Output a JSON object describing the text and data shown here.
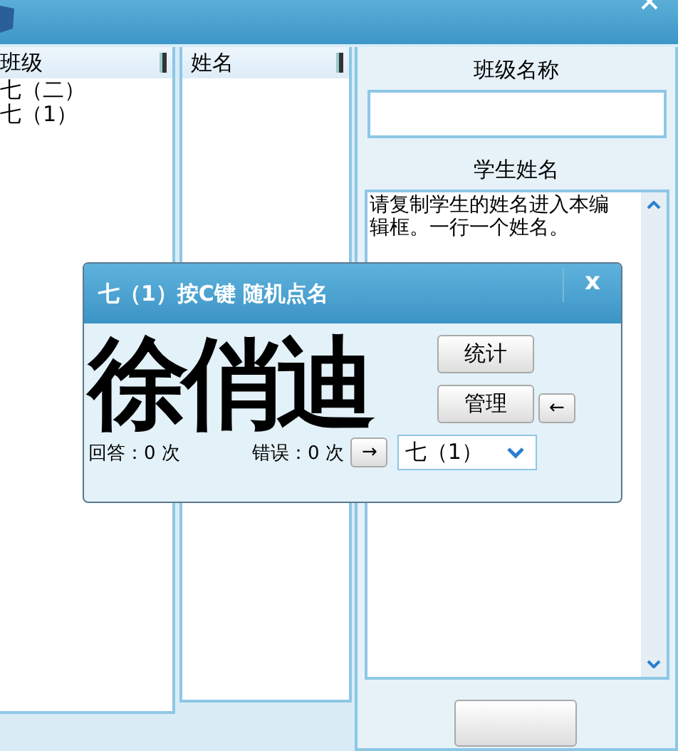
{
  "class_list": {
    "header": "班级",
    "items": [
      {
        "label": "七（二）"
      },
      {
        "label": "七（1）"
      }
    ]
  },
  "name_list": {
    "header": "姓名"
  },
  "editor": {
    "class_name_label": "班级名称",
    "student_names_label": "学生姓名",
    "student_names_text": "请复制学生的姓名进入本编辑框。一行一个姓名。"
  },
  "dialog": {
    "title": "七（1）按C键 随机点名",
    "close": "x",
    "picked_name": "徐俏迪",
    "buttons": [
      "统计",
      "管理"
    ],
    "back_button": "←",
    "forward_button": "→",
    "answers": "回答：0 次",
    "errors": "错误：0 次",
    "class_select": {
      "value": "七（1）"
    }
  }
}
